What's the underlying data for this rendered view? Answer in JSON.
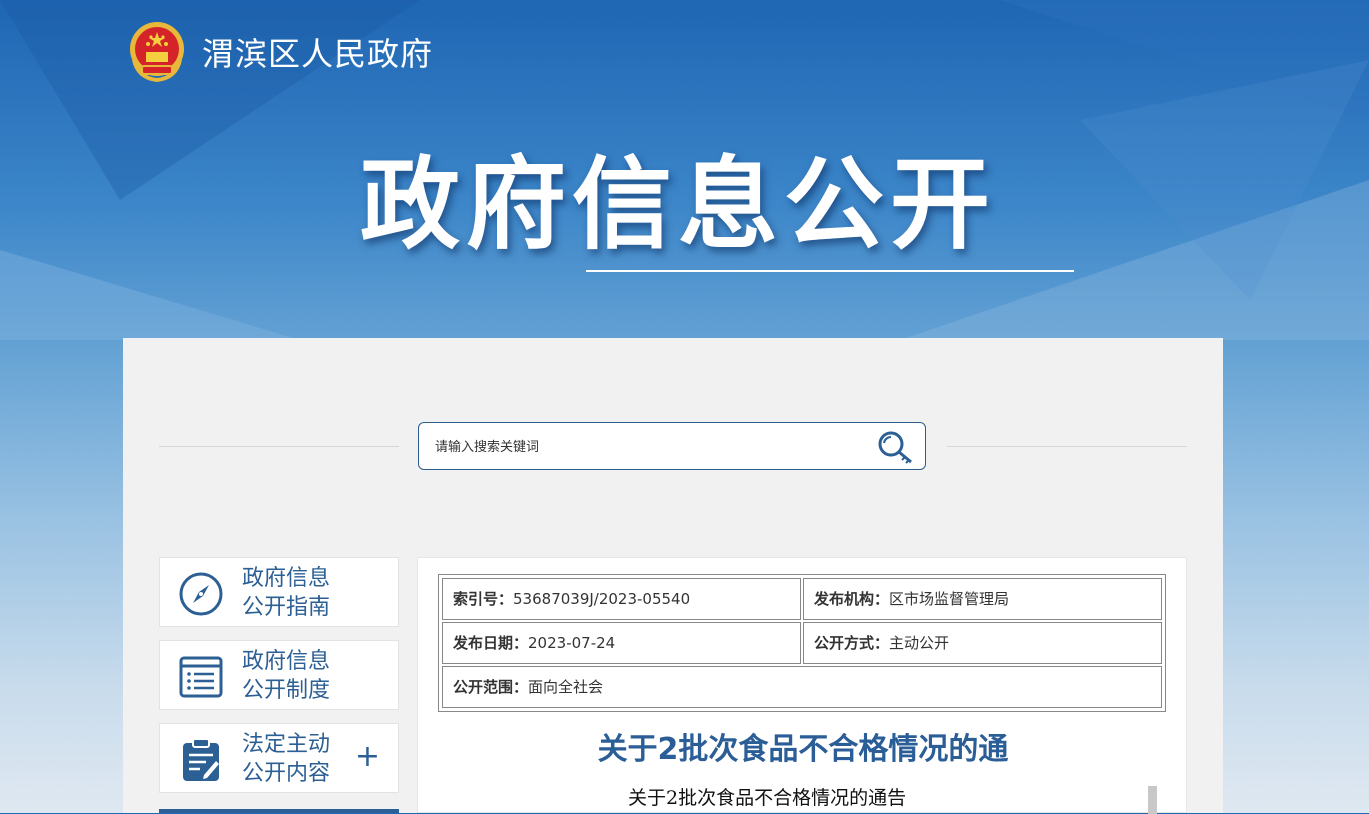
{
  "header": {
    "site_name": "渭滨区人民政府",
    "hero_title": "政府信息公开",
    "logo_icon": "national-emblem-icon"
  },
  "search": {
    "placeholder": "请输入搜索关键词",
    "icon": "search-key-icon"
  },
  "sidebar": {
    "items": [
      {
        "label": "政府信息公开指南",
        "line1": "政府信息",
        "line2": "公开指南",
        "icon": "compass-icon"
      },
      {
        "label": "政府信息公开制度",
        "line1": "政府信息",
        "line2": "公开制度",
        "icon": "document-list-icon"
      },
      {
        "label": "法定主动公开内容",
        "line1": "法定主动",
        "line2": "公开内容",
        "icon": "clipboard-edit-icon",
        "expand": "+"
      }
    ]
  },
  "article": {
    "meta": {
      "index_label": "索引号：",
      "index_value": "53687039J/2023-05540",
      "publisher_label": "发布机构：",
      "publisher_value": "区市场监督管理局",
      "date_label": "发布日期：",
      "date_value": "2023-07-24",
      "mode_label": "公开方式：",
      "mode_value": "主动公开",
      "scope_label": "公开范围：",
      "scope_value": "面向全社会"
    },
    "title": "关于2批次食品不合格情况的通",
    "subtitle": "关于2批次食品不合格情况的通告"
  },
  "colors": {
    "brand_blue": "#2c5f93",
    "title_blue": "#2b5d97",
    "panel_bg": "#f1f1f1"
  }
}
